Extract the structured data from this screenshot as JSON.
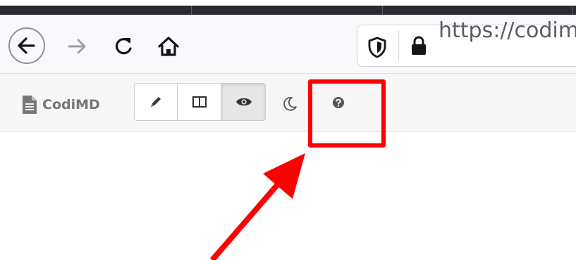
{
  "browser": {
    "url": "https://codimd",
    "icons": {
      "back": "arrow-left-icon",
      "forward": "arrow-right-icon",
      "reload": "reload-icon",
      "home": "home-icon",
      "tracking_protection": "shield-icon",
      "secure": "lock-icon"
    }
  },
  "app": {
    "brand": "CodiMD",
    "brand_icon": "file-text-icon",
    "view_modes": [
      "edit",
      "both",
      "view"
    ],
    "active_mode": "view",
    "night_mode_icon": "moon-icon",
    "help_icon": "question-circle-icon"
  },
  "annotation": {
    "highlight_color": "#ff0000",
    "target": "help-button"
  }
}
